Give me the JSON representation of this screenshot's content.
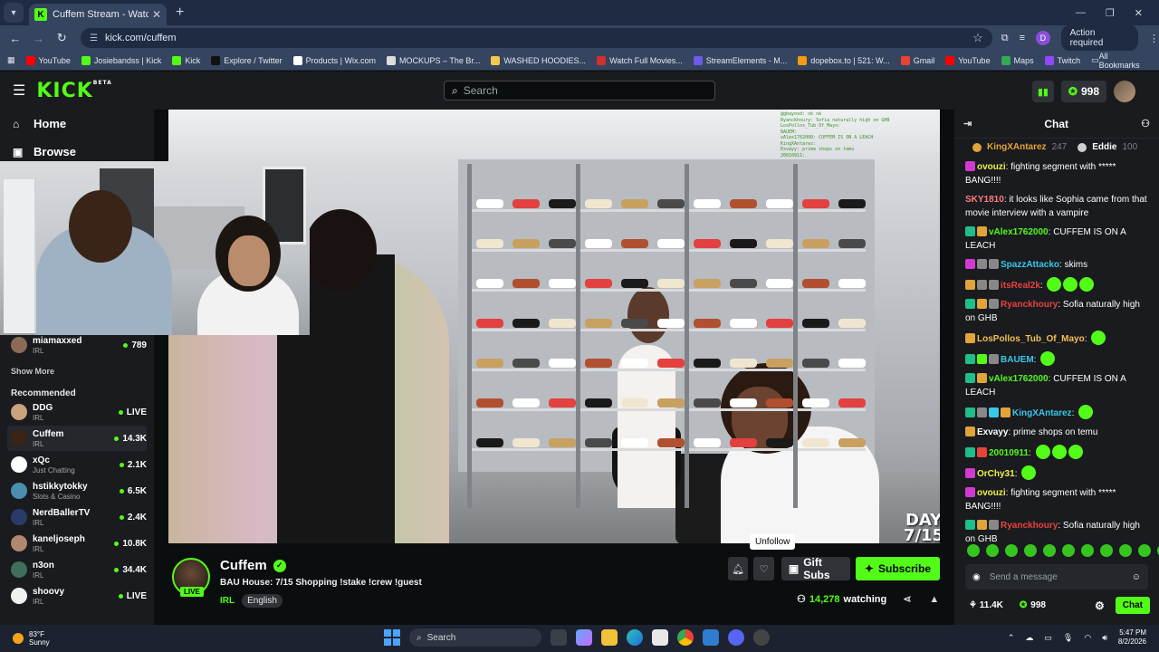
{
  "browser": {
    "tab_title": "Cuffem Stream - Watch Live on",
    "tab_favicon": "K",
    "url": "kick.com/cuffem",
    "action_required": "Action required",
    "profile_letter": "D",
    "bookmarks": [
      {
        "label": "YouTube",
        "color": "#ff0000"
      },
      {
        "label": "Josiebandss | Kick",
        "color": "#53fc18"
      },
      {
        "label": "Kick",
        "color": "#53fc18"
      },
      {
        "label": "Explore / Twitter",
        "color": "#111111"
      },
      {
        "label": "Products | Wix.com",
        "color": "#ffffff"
      },
      {
        "label": "MOCKUPS – The Br...",
        "color": "#dddddd"
      },
      {
        "label": "WASHED HOODIES...",
        "color": "#f2c94c"
      },
      {
        "label": "Watch Full Movies...",
        "color": "#d03030"
      },
      {
        "label": "StreamElements - M...",
        "color": "#6c5ce7"
      },
      {
        "label": "dopebox.to | 521: W...",
        "color": "#f39c12"
      },
      {
        "label": "Gmail",
        "color": "#ea4335"
      },
      {
        "label": "YouTube",
        "color": "#ff0000"
      },
      {
        "label": "Maps",
        "color": "#34a853"
      },
      {
        "label": "Twitch",
        "color": "#9146ff"
      }
    ],
    "all_bookmarks": "All Bookmarks"
  },
  "header": {
    "logo": "KICK",
    "logo_badge": "BETA",
    "search_placeholder": "Search",
    "points": "998"
  },
  "sidebar": {
    "nav": [
      {
        "label": "Home",
        "icon": "home-icon"
      },
      {
        "label": "Browse",
        "icon": "browse-icon"
      }
    ],
    "following_partial": {
      "name": "miamaxxed",
      "category": "IRL",
      "count": "789"
    },
    "show_more": "Show More",
    "recommended_label": "Recommended",
    "recommended": [
      {
        "name": "DDG",
        "category": "IRL",
        "count": "LIVE",
        "color": "#c9a27e"
      },
      {
        "name": "Cuffem",
        "category": "IRL",
        "count": "14.3K",
        "color": "#3a2418"
      },
      {
        "name": "xQc",
        "category": "Just Chatting",
        "count": "2.1K",
        "color": "#ffffff"
      },
      {
        "name": "hstikkytokky",
        "category": "Slots & Casino",
        "count": "6.5K",
        "color": "#4a8fb0"
      },
      {
        "name": "NerdBallerTV",
        "category": "IRL",
        "count": "2.4K",
        "color": "#2a3b6a"
      },
      {
        "name": "kaneljoseph",
        "category": "IRL",
        "count": "10.8K",
        "color": "#b08870"
      },
      {
        "name": "n3on",
        "category": "IRL",
        "count": "34.4K",
        "color": "#3d6f5a"
      },
      {
        "name": "shoovy",
        "category": "IRL",
        "count": "LIVE",
        "color": "#f0f0f0"
      }
    ]
  },
  "video": {
    "day_text": "DAY",
    "day_num": "7/15",
    "overlay_chat": [
      "@gbayoxd: ok ok",
      "Ryanckhoury: Sofia naturally high on GHB",
      "LosPollos_Tub_Of_Mayo:",
      "BAUEM:",
      "vAlex1762000: CUFFEM IS ON A LEACH",
      "KingXAntarez:",
      "Exvayy: prime shops on temu",
      "20010911:"
    ]
  },
  "stream": {
    "channel": "Cuffem",
    "live_label": "LIVE",
    "title": "BAU House: 7/15 Shopping !stake !crew !guest",
    "category": "IRL",
    "language": "English",
    "tooltip": "Unfollow",
    "gift_subs": "Gift Subs",
    "subscribe": "Subscribe",
    "viewers": "14,278",
    "watching_label": "watching"
  },
  "chat": {
    "title": "Chat",
    "top_gifters": [
      {
        "name": "KingXAntarez",
        "count": "247"
      },
      {
        "name": "Eddie",
        "count": "100"
      }
    ],
    "messages": [
      {
        "user": "ovouzi",
        "color": "#f0f04a",
        "badges": [
          "#d13ad1"
        ],
        "text": "fighting segment with ***** BANG!!!!",
        "emotes": 0
      },
      {
        "user": "SKY1810",
        "color": "#ff7d7d",
        "badges": [],
        "text": "it looks like Sophia came from that movie interview with a vampire",
        "emotes": 0
      },
      {
        "user": "vAlex1762000",
        "color": "#53fc18",
        "badges": [
          "#1ebf8a",
          "#e2a33a"
        ],
        "text": "CUFFEM IS ON A LEACH",
        "emotes": 0
      },
      {
        "user": "SpazzAttacko",
        "color": "#38c8e8",
        "badges": [
          "#d13ad1",
          "#888888",
          "#888888"
        ],
        "text": "skims",
        "emotes": 0
      },
      {
        "user": "itsReal2k",
        "color": "#e8423f",
        "badges": [
          "#e2a33a",
          "#888888",
          "#888888"
        ],
        "text": "",
        "emotes": 3
      },
      {
        "user": "Ryanckhoury",
        "color": "#e8423f",
        "badges": [
          "#1ebf8a",
          "#e2a33a",
          "#888888"
        ],
        "text": "Sofia naturally high on GHB",
        "emotes": 0
      },
      {
        "user": "LosPollos_Tub_Of_Mayo",
        "color": "#f0c050",
        "badges": [
          "#e2a33a"
        ],
        "text": "",
        "emotes": 1
      },
      {
        "user": "BAUEM",
        "color": "#38c8e8",
        "badges": [
          "#1ebf8a",
          "#53fc18",
          "#888888"
        ],
        "text": "",
        "emotes": 1
      },
      {
        "user": "vAlex1762000",
        "color": "#53fc18",
        "badges": [
          "#1ebf8a",
          "#e2a33a"
        ],
        "text": "CUFFEM IS ON A LEACH",
        "emotes": 0
      },
      {
        "user": "KingXAntarez",
        "color": "#38c8e8",
        "badges": [
          "#1ebf8a",
          "#888888",
          "#38c8e8",
          "#e2a33a"
        ],
        "text": "",
        "emotes": 1
      },
      {
        "user": "Exvayy",
        "color": "#ffffff",
        "badges": [
          "#e2a33a"
        ],
        "text": "prime shops on temu",
        "emotes": 0
      },
      {
        "user": "20010911",
        "color": "#53fc18",
        "badges": [
          "#1ebf8a",
          "#e8423f"
        ],
        "text": "",
        "emotes": 3
      },
      {
        "user": "OrChy31",
        "color": "#f0f04a",
        "badges": [
          "#d13ad1"
        ],
        "text": "",
        "emotes": 1
      },
      {
        "user": "ovouzi",
        "color": "#f0f04a",
        "badges": [
          "#d13ad1"
        ],
        "text": "fighting segment with ***** BANG!!!!",
        "emotes": 0
      },
      {
        "user": "Ryanckhoury",
        "color": "#e8423f",
        "badges": [
          "#1ebf8a",
          "#e2a33a",
          "#888888"
        ],
        "text": "Sofia naturally high on GHB",
        "emotes": 0
      }
    ],
    "input_placeholder": "Send a message",
    "followers": "11.4K",
    "points": "998",
    "chat_button": "Chat"
  },
  "taskbar": {
    "temp": "83°F",
    "condition": "Sunny",
    "search": "Search",
    "time": "5:47 PM",
    "date": "8/2/2026"
  }
}
